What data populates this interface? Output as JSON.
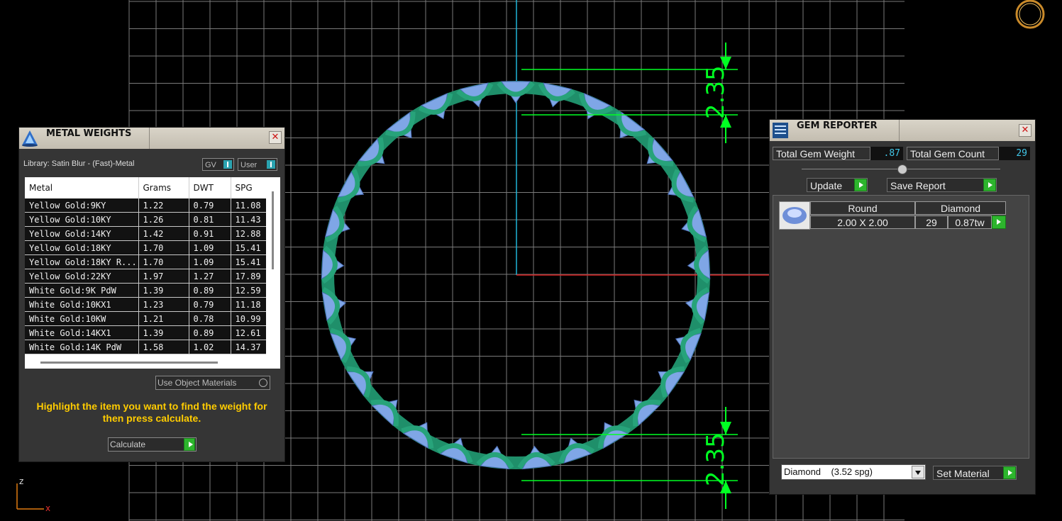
{
  "metal_weights": {
    "title": "METAL WEIGHTS",
    "library_label": "Library: Satin Blur - (Fast)-Metal",
    "gv_label": "GV",
    "user_label": "User",
    "columns": [
      "Metal",
      "Grams",
      "DWT",
      "SPG"
    ],
    "rows": [
      {
        "metal": "Yellow Gold:9KY",
        "grams": "1.22",
        "dwt": "0.79",
        "spg": "11.08"
      },
      {
        "metal": "Yellow Gold:10KY",
        "grams": "1.26",
        "dwt": "0.81",
        "spg": "11.43"
      },
      {
        "metal": "Yellow Gold:14KY",
        "grams": "1.42",
        "dwt": "0.91",
        "spg": "12.88"
      },
      {
        "metal": "Yellow Gold:18KY",
        "grams": "1.70",
        "dwt": "1.09",
        "spg": "15.41"
      },
      {
        "metal": "Yellow Gold:18KY R...",
        "grams": "1.70",
        "dwt": "1.09",
        "spg": "15.41"
      },
      {
        "metal": "Yellow Gold:22KY",
        "grams": "1.97",
        "dwt": "1.27",
        "spg": "17.89"
      },
      {
        "metal": "White Gold:9K PdW",
        "grams": "1.39",
        "dwt": "0.89",
        "spg": "12.59"
      },
      {
        "metal": "White Gold:10KX1",
        "grams": "1.23",
        "dwt": "0.79",
        "spg": "11.18"
      },
      {
        "metal": "White Gold:10KW",
        "grams": "1.21",
        "dwt": "0.78",
        "spg": "10.99"
      },
      {
        "metal": "White Gold:14KX1",
        "grams": "1.39",
        "dwt": "0.89",
        "spg": "12.61"
      },
      {
        "metal": "White Gold:14K PdW",
        "grams": "1.58",
        "dwt": "1.02",
        "spg": "14.37"
      }
    ],
    "use_object_materials_label": "Use Object Materials",
    "instruction": "Highlight the item you want to find the weight for then press calculate.",
    "calculate_label": "Calculate"
  },
  "gem_reporter": {
    "title": "GEM REPORTER",
    "total_weight_label": "Total Gem Weight",
    "total_weight_value": ".87",
    "total_count_label": "Total Gem Count",
    "total_count_value": "29",
    "update_label": "Update",
    "save_report_label": "Save Report",
    "gem_row": {
      "shape": "Round",
      "material": "Diamond",
      "size": "2.00 X 2.00",
      "count": "29",
      "weight": "0.87tw"
    },
    "material_select": "Diamond    (3.52 spg)",
    "set_material_label": "Set Material"
  },
  "viewport": {
    "dimension_top": "2.35",
    "dimension_bottom": "2.35",
    "axis_z": "z",
    "axis_x": "x",
    "band_color": "#1f8f6a",
    "gem_color": "#7fa6e6",
    "dimension_color": "#00ff22",
    "grid_color": "#7a7a7a"
  }
}
